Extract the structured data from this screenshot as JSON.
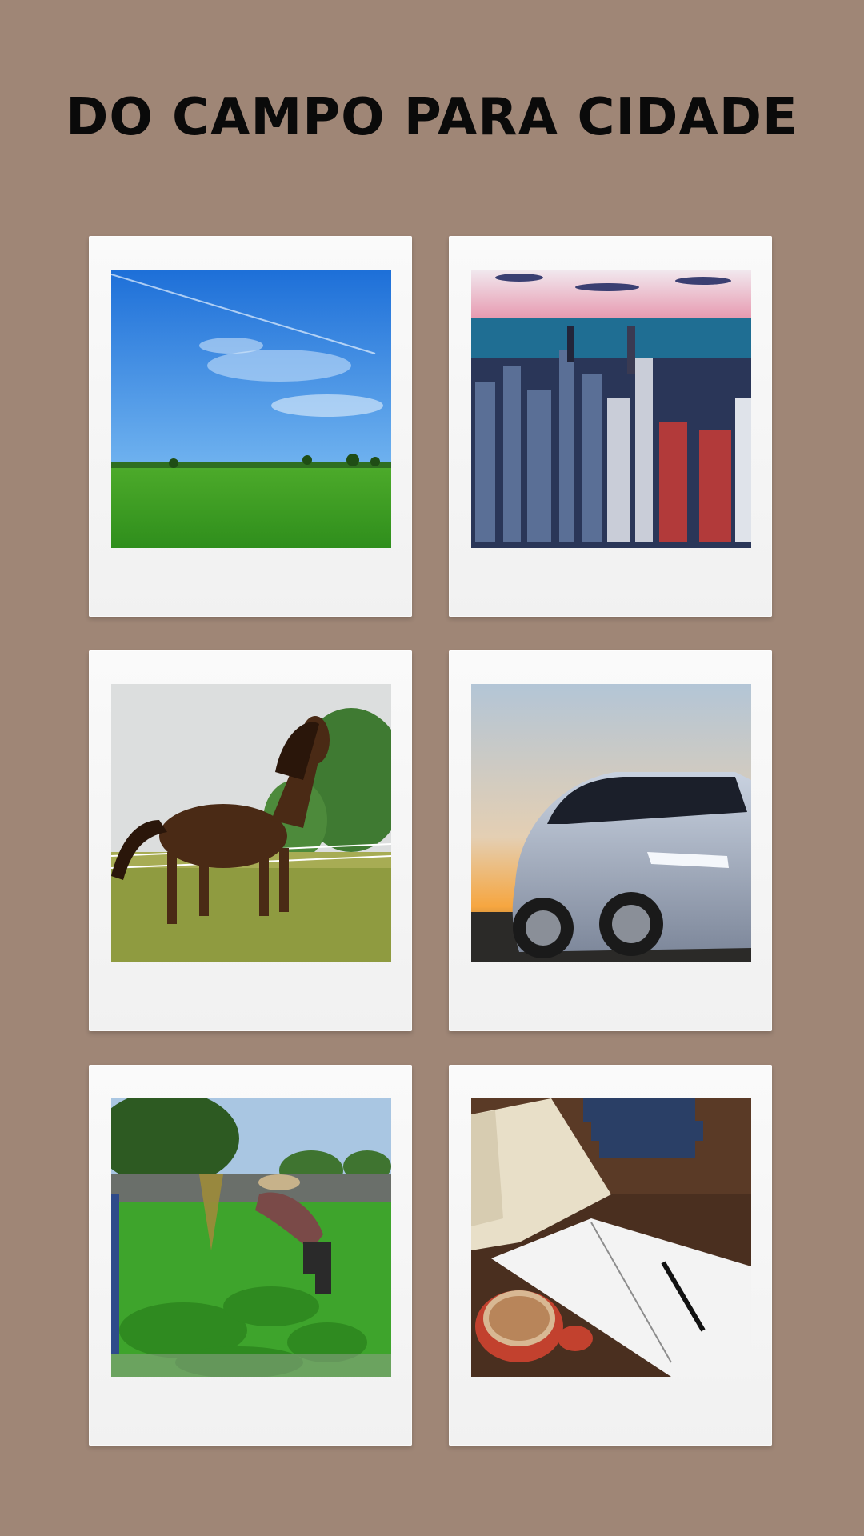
{
  "title": "DO CAMPO PARA CIDADE"
}
